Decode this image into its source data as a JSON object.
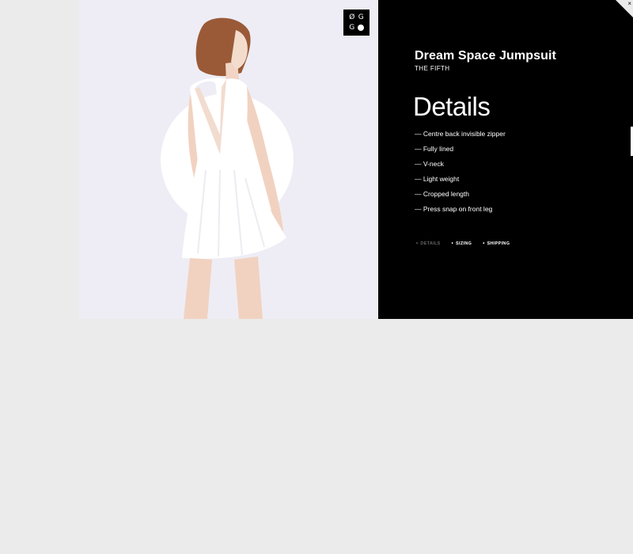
{
  "product": {
    "name": "Dream Space Jumpsuit",
    "brand": "THE FIFTH"
  },
  "logo": {
    "top_left": "Ø",
    "top_right": "G",
    "bottom_left": "G",
    "bottom_right_icon": "filled-circle"
  },
  "details": {
    "title": "Details",
    "items": [
      "— Centre back invisible zipper",
      "— Fully lined",
      "— V-neck",
      "— Light weight",
      "— Cropped length",
      "— Press snap on front leg"
    ]
  },
  "tabs": [
    {
      "label": "DETAILS",
      "active": true
    },
    {
      "label": "SIZING",
      "active": false
    },
    {
      "label": "SHIPPING",
      "active": false
    }
  ],
  "close": {
    "label": "×"
  },
  "colors": {
    "page_background": "#ebebeb",
    "image_background": "#eeedf5",
    "panel": "#000000",
    "text": "#ffffff",
    "inactive_tab": "#666666"
  }
}
